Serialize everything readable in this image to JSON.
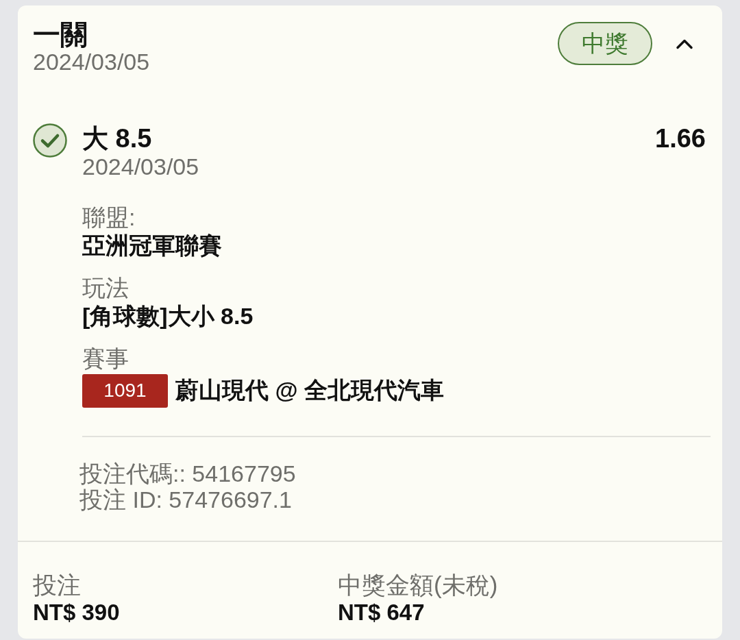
{
  "bet": {
    "title": "一關",
    "date": "2024/03/05",
    "status": {
      "label": "中獎",
      "kind": "won"
    },
    "expanded": true
  },
  "selections": [
    {
      "kind": "won",
      "pick": "大 8.5",
      "date": "2024/03/05",
      "odds": "1.66",
      "details": [
        {
          "label": "聯盟:",
          "value": "亞洲冠軍聯賽"
        },
        {
          "label": "玩法",
          "value": "[角球數]大小 8.5"
        },
        {
          "label": "賽事",
          "match_code": "1091",
          "value": "蔚山現代 @ 全北現代汽車"
        }
      ],
      "bet_code": "投注代碼:: 54167795",
      "bet_id": "投注 ID: 57476697.1"
    }
  ],
  "totals": [
    {
      "label": "投注",
      "amount": "NT$ 390"
    },
    {
      "label": "中獎金額(未稅)",
      "amount": "NT$ 647"
    }
  ]
}
